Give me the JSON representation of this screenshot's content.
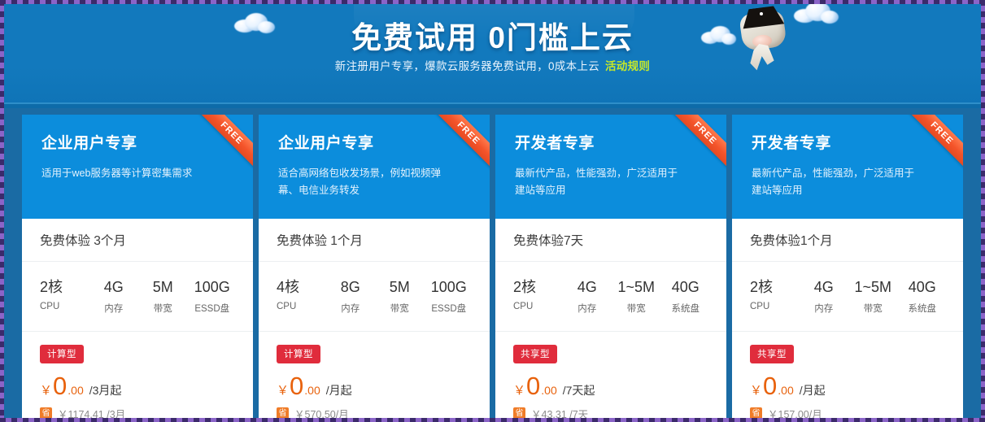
{
  "banner": {
    "title": "免费试用 0门槛上云",
    "subtitle": "新注册用户专享，爆款云服务器免费试用，0成本上云",
    "rule_link": "活动规则",
    "link_color": "#c6e82a",
    "background_color": "#1279bd"
  },
  "ribbon_label": "FREE",
  "cards": [
    {
      "title": "企业用户专享",
      "desc": "适用于web服务器等计算密集需求",
      "trial": "免费体验 3个月",
      "specs": [
        {
          "value": "2核",
          "label": "CPU"
        },
        {
          "value": "4G",
          "label": "内存"
        },
        {
          "value": "5M",
          "label": "带宽"
        },
        {
          "value": "100G",
          "label": "ESSD盘"
        }
      ],
      "type_tag": "计算型",
      "price_yen": "￥",
      "price_int": "0",
      "price_dec": ".00",
      "price_unit": "/3月起",
      "save_badge": "省",
      "original_price": "￥1174.41 /3月"
    },
    {
      "title": "企业用户专享",
      "desc": "适合高网络包收发场景，例如视频弹幕、电信业务转发",
      "trial": "免费体验 1个月",
      "specs": [
        {
          "value": "4核",
          "label": "CPU"
        },
        {
          "value": "8G",
          "label": "内存"
        },
        {
          "value": "5M",
          "label": "带宽"
        },
        {
          "value": "100G",
          "label": "ESSD盘"
        }
      ],
      "type_tag": "计算型",
      "price_yen": "￥",
      "price_int": "0",
      "price_dec": ".00",
      "price_unit": "/月起",
      "save_badge": "省",
      "original_price": "￥570.50/月"
    },
    {
      "title": "开发者专享",
      "desc": "最新代产品，性能强劲，广泛适用于建站等应用",
      "trial": "免费体验7天",
      "specs": [
        {
          "value": "2核",
          "label": "CPU"
        },
        {
          "value": "4G",
          "label": "内存"
        },
        {
          "value": "1~5M",
          "label": "带宽"
        },
        {
          "value": "40G",
          "label": "系统盘"
        }
      ],
      "type_tag": "共享型",
      "price_yen": "￥",
      "price_int": "0",
      "price_dec": ".00",
      "price_unit": "/7天起",
      "save_badge": "省",
      "original_price": "￥43.31 /7天"
    },
    {
      "title": "开发者专享",
      "desc": "最新代产品，性能强劲，广泛适用于建站等应用",
      "trial": "免费体验1个月",
      "specs": [
        {
          "value": "2核",
          "label": "CPU"
        },
        {
          "value": "4G",
          "label": "内存"
        },
        {
          "value": "1~5M",
          "label": "带宽"
        },
        {
          "value": "40G",
          "label": "系统盘"
        }
      ],
      "type_tag": "共享型",
      "price_yen": "￥",
      "price_int": "0",
      "price_dec": ".00",
      "price_unit": "/月起",
      "save_badge": "省",
      "original_price": "￥157.00/月"
    }
  ],
  "theme": {
    "card_header_blue": "#0c8ddc",
    "ribbon_orange": "#f4542a",
    "tag_red": "#e02c3c",
    "price_orange": "#e8620d",
    "save_orange": "#f07c28"
  }
}
